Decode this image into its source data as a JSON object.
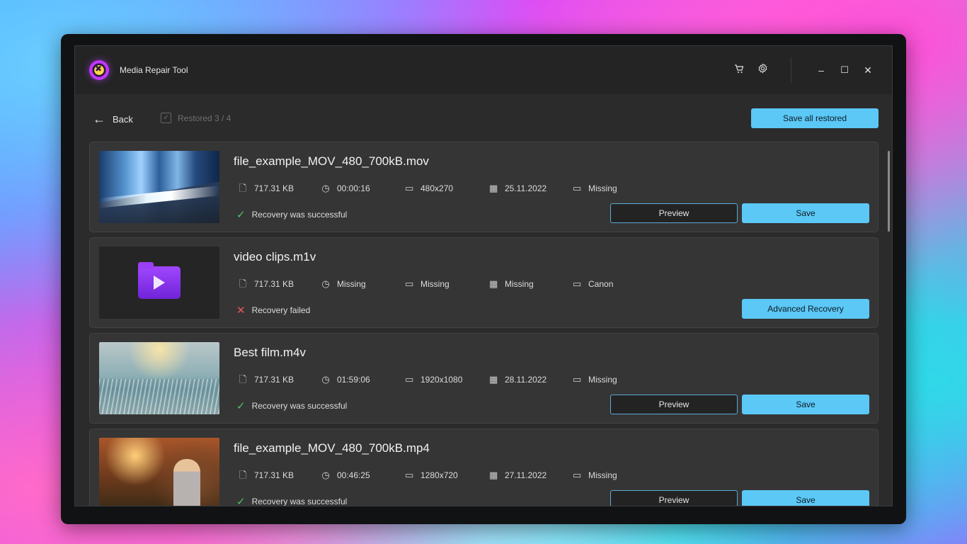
{
  "app": {
    "title": "Media Repair Tool"
  },
  "titlebar": {
    "cart_icon": "cart-icon",
    "settings_icon": "gear-icon",
    "minimize": "–",
    "maximize": "☐",
    "close": "✕"
  },
  "toolbar": {
    "back_label": "Back",
    "restored_label": "Restored 3 / 4",
    "save_all_label": "Save all restored"
  },
  "files": [
    {
      "name": "file_example_MOV_480_700kB.mov",
      "size": "717.31 KB",
      "duration": "00:00:16",
      "resolution": "480x270",
      "date": "25.11.2022",
      "camera": "Missing",
      "status": "Recovery was successful",
      "success": true,
      "preview_label": "Preview",
      "save_label": "Save"
    },
    {
      "name": "video clips.m1v",
      "size": "717.31 KB",
      "duration": "Missing",
      "resolution": "Missing",
      "date": "Missing",
      "camera": "Canon",
      "status": "Recovery failed",
      "success": false,
      "advanced_label": "Advanced Recovery"
    },
    {
      "name": "Best film.m4v",
      "size": "717.31 KB",
      "duration": "01:59:06",
      "resolution": "1920x1080",
      "date": "28.11.2022",
      "camera": "Missing",
      "status": "Recovery was successful",
      "success": true,
      "preview_label": "Preview",
      "save_label": "Save"
    },
    {
      "name": "file_example_MOV_480_700kB.mp4",
      "size": "717.31 KB",
      "duration": "00:46:25",
      "resolution": "1280x720",
      "date": "27.11.2022",
      "camera": "Missing",
      "status": "Recovery was successful",
      "success": true,
      "preview_label": "Preview",
      "save_label": "Save"
    }
  ],
  "colors": {
    "accent": "#5bc8f6",
    "success": "#4cc36a",
    "error": "#e85a5a",
    "background": "#2b2b2b",
    "card": "#353535"
  }
}
